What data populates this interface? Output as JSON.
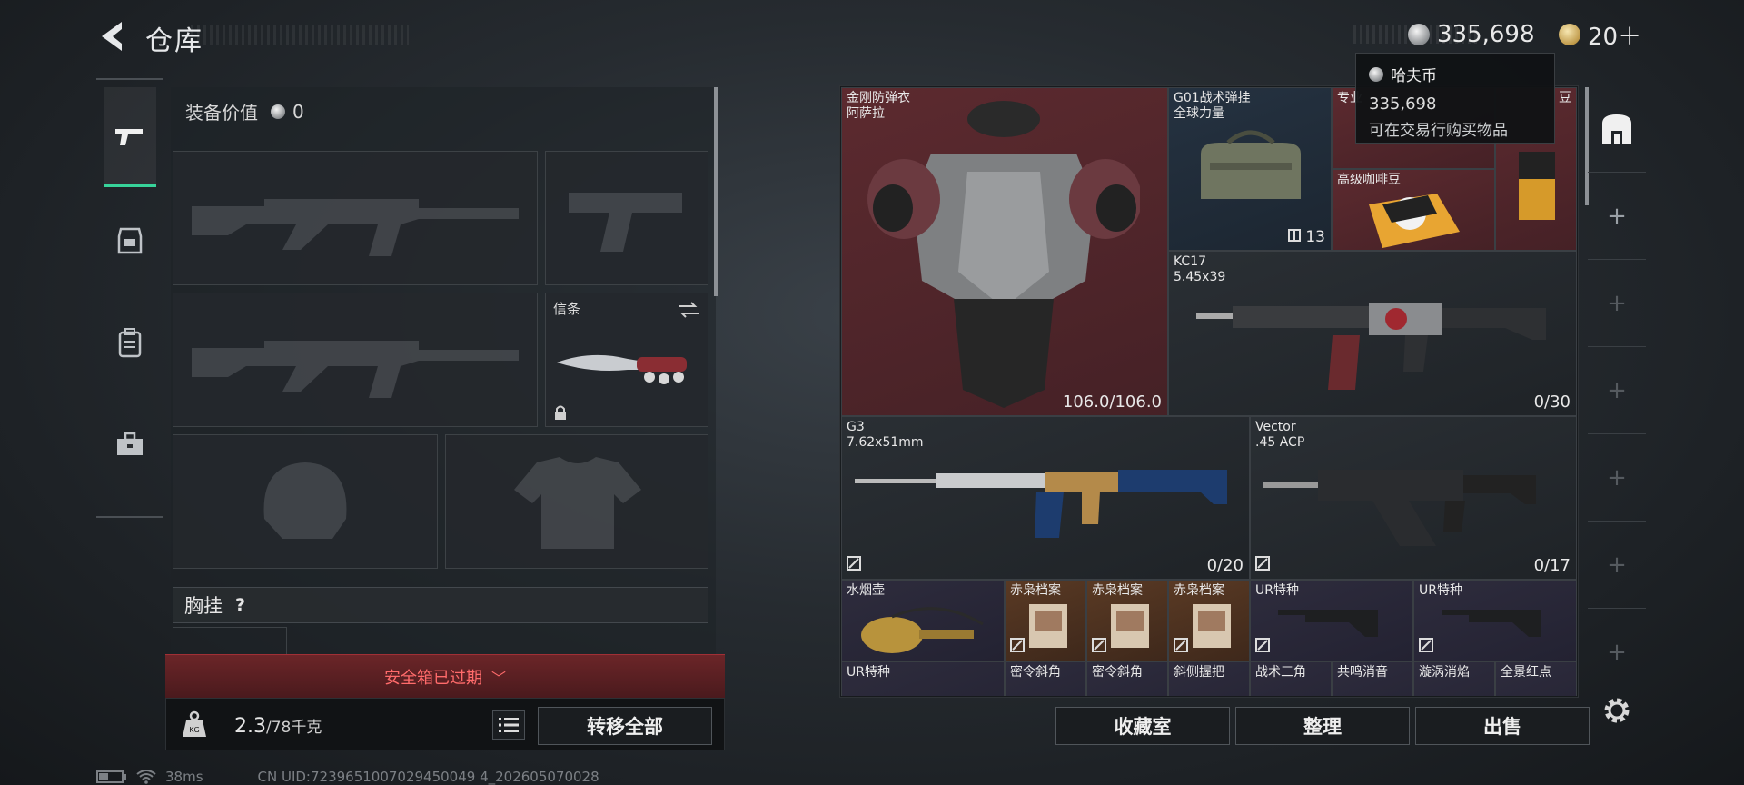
{
  "header": {
    "title": "仓库",
    "currency_amount": "335,698",
    "ticket_amount": "20＋"
  },
  "tooltip": {
    "name": "哈夫币",
    "amount": "335,698",
    "desc": "可在交易行购买物品"
  },
  "equip": {
    "value_label": "装备价值",
    "value_amount": "0",
    "melee_label": "信条",
    "chest_rig_label": "胸挂",
    "chest_help": "?",
    "safe_box_text": "安全箱已过期",
    "weight_value": "2.3",
    "weight_max": "/78千克",
    "transfer_all": "转移全部"
  },
  "status": {
    "ping": "38ms",
    "uid": "CN UID:7239651007029450049 4_202605070028"
  },
  "stash": {
    "items": [
      {
        "name": "金刚防弹衣\n阿萨拉",
        "stat": "106.0/106.0"
      },
      {
        "name": "G01战术弹挂\n全球力量",
        "stat": "13"
      },
      {
        "name": "专业",
        "stat": ""
      },
      {
        "name": "高级咖啡豆",
        "stat": ""
      },
      {
        "name": "豆",
        "stat": ""
      },
      {
        "name": "KC17\n5.45x39",
        "stat": "0/30"
      },
      {
        "name": "G3\n7.62x51mm",
        "stat": "0/20"
      },
      {
        "name": "Vector\n.45 ACP",
        "stat": "0/17"
      },
      {
        "name": "水烟壶",
        "stat": ""
      },
      {
        "name": "赤枭档案",
        "stat": ""
      },
      {
        "name": "赤枭档案",
        "stat": ""
      },
      {
        "name": "赤枭档案",
        "stat": ""
      },
      {
        "name": "UR特种",
        "stat": ""
      },
      {
        "name": "UR特种",
        "stat": ""
      },
      {
        "name": "UR特种",
        "stat": ""
      },
      {
        "name": "密令斜角",
        "stat": ""
      },
      {
        "name": "密令斜角",
        "stat": ""
      },
      {
        "name": "斜侧握把",
        "stat": ""
      },
      {
        "name": "战术三角",
        "stat": ""
      },
      {
        "name": "共鸣消音",
        "stat": ""
      },
      {
        "name": "漩涡消焰",
        "stat": ""
      },
      {
        "name": "全景红点",
        "stat": ""
      }
    ]
  },
  "buttons": {
    "collection": "收藏室",
    "sort": "整理",
    "sell": "出售"
  },
  "colors": {
    "accent": "#37d39a",
    "danger": "#ff6b6b",
    "rarity_red": "#5c2a2f",
    "rarity_gold": "#5a3a24",
    "rarity_purple": "#2e2c3d"
  }
}
